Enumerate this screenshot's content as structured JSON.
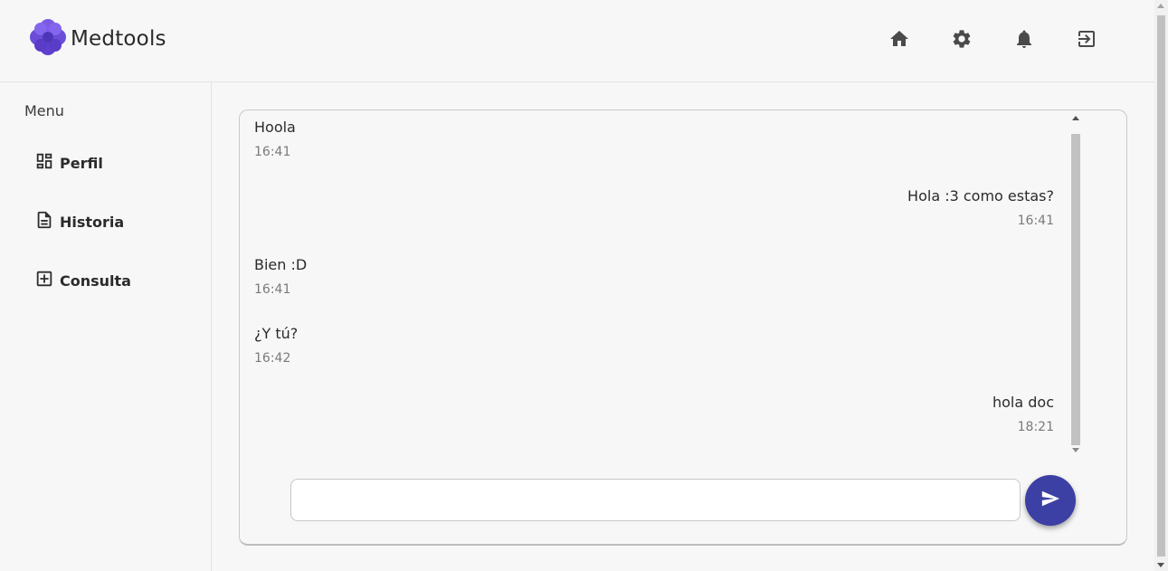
{
  "header": {
    "brand_name": "Medtools",
    "logo_icon": "flower-logo-icon",
    "icons": [
      "home-icon",
      "gear-icon",
      "bell-icon",
      "logout-icon"
    ]
  },
  "sidebar": {
    "menu_title": "Menu",
    "items": [
      {
        "label": "Perfil",
        "icon": "dashboard-icon"
      },
      {
        "label": "Historia",
        "icon": "document-icon"
      },
      {
        "label": "Consulta",
        "icon": "add-box-icon"
      }
    ]
  },
  "chat": {
    "messages": [
      {
        "text": "Hoola",
        "time": "16:41",
        "side": "left"
      },
      {
        "text": "Hola :3 como estas?",
        "time": "16:41",
        "side": "right"
      },
      {
        "text": "Bien :D",
        "time": "16:41",
        "side": "left"
      },
      {
        "text": "¿Y tú?",
        "time": "16:42",
        "side": "left"
      },
      {
        "text": "hola doc",
        "time": "18:21",
        "side": "right"
      }
    ],
    "input_value": "",
    "send_icon": "send-icon"
  },
  "colors": {
    "accent": "#3c3fa3",
    "logo": "#6a4ed8",
    "background": "#f7f7f7"
  }
}
